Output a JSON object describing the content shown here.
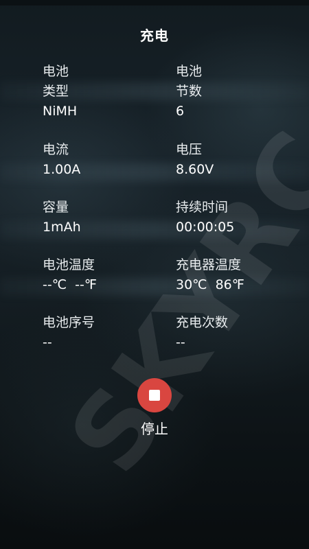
{
  "header": {
    "title": "充电"
  },
  "fields": {
    "battery_type": {
      "label_line1": "电池",
      "label_line2": "类型",
      "value": "NiMH"
    },
    "battery_cells": {
      "label_line1": "电池",
      "label_line2": "节数",
      "value": "6"
    },
    "current": {
      "label": "电流",
      "value": "1.00A"
    },
    "voltage": {
      "label": "电压",
      "value": "8.60V"
    },
    "capacity": {
      "label": "容量",
      "value": "1mAh"
    },
    "duration": {
      "label": "持续时间",
      "value": "00:00:05"
    },
    "battery_temp": {
      "label": "电池温度",
      "value": "--℃  --℉"
    },
    "charger_temp": {
      "label": "充电器温度",
      "value": "30℃  86℉"
    },
    "battery_serial": {
      "label": "电池序号",
      "value": "--"
    },
    "charge_count": {
      "label": "充电次数",
      "value": "--"
    }
  },
  "stop": {
    "label": "停止"
  },
  "watermark": {
    "text": "SKYRC"
  },
  "colors": {
    "stop_button": "#d94640",
    "text": "#ffffff",
    "background": "#121b20"
  }
}
